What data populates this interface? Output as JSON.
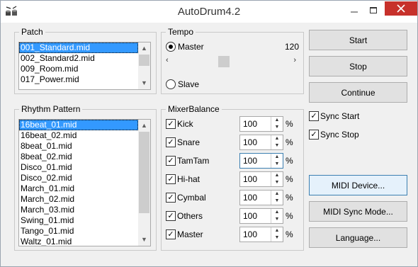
{
  "window": {
    "title": "AutoDrum4.2"
  },
  "patch": {
    "label": "Patch",
    "items": [
      "001_Standard.mid",
      "002_Standard2.mid",
      "009_Room.mid",
      "017_Power.mid"
    ],
    "selected": 0
  },
  "rhythm": {
    "label": "Rhythm Pattern",
    "items": [
      "16beat_01.mid",
      "16beat_02.mid",
      "8beat_01.mid",
      "8beat_02.mid",
      "Disco_01.mid",
      "Disco_02.mid",
      "March_01.mid",
      "March_02.mid",
      "March_03.mid",
      "Swing_01.mid",
      "Tango_01.mid",
      "Waltz_01.mid"
    ],
    "selected": 0
  },
  "tempo": {
    "label": "Tempo",
    "master_label": "Master",
    "value": "120",
    "slave_label": "Slave",
    "mode": "Master",
    "slider_fraction": 0.43
  },
  "mixer": {
    "label": "MixerBalance",
    "unit": "%",
    "channels": [
      {
        "name": "Kick",
        "value": "100",
        "checked": true
      },
      {
        "name": "Snare",
        "value": "100",
        "checked": true
      },
      {
        "name": "TamTam",
        "value": "100",
        "checked": true
      },
      {
        "name": "Hi-hat",
        "value": "100",
        "checked": true
      },
      {
        "name": "Cymbal",
        "value": "100",
        "checked": true
      },
      {
        "name": "Others",
        "value": "100",
        "checked": true
      },
      {
        "name": "Master",
        "value": "100",
        "checked": true
      }
    ]
  },
  "buttons": {
    "start": "Start",
    "stop": "Stop",
    "continue": "Continue",
    "midi_device": "MIDI Device...",
    "midi_sync_mode": "MIDI Sync Mode...",
    "language": "Language..."
  },
  "sync": {
    "sync_start": "Sync Start",
    "sync_start_checked": true,
    "sync_stop": "Sync Stop",
    "sync_stop_checked": true
  },
  "icons": {
    "app": "drum-kit-icon",
    "minimize": "minimize-icon",
    "maximize": "maximize-icon",
    "close": "close-icon"
  }
}
